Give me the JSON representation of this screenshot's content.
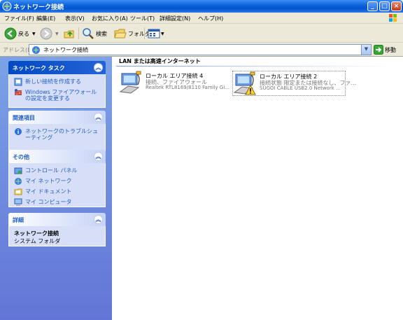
{
  "window": {
    "title": "ネットワーク接続"
  },
  "menubar": [
    "ファイル(F)",
    "編集(E)",
    "表示(V)",
    "お気に入り(A)",
    "ツール(T)",
    "詳細設定(N)",
    "ヘルプ(H)"
  ],
  "toolbar": {
    "back": "戻る",
    "search": "検索",
    "folders": "フォルダ"
  },
  "address": {
    "label": "アドレス(D)",
    "value": "ネットワーク接続",
    "go": "移動"
  },
  "sidebar": {
    "tasks": {
      "title": "ネットワーク タスク",
      "items": [
        "新しい接続を作成する",
        "Windows ファイアウォールの設定を変更する"
      ]
    },
    "related": {
      "title": "関連項目",
      "items": [
        "ネットワークのトラブルシューティング"
      ]
    },
    "other": {
      "title": "その他",
      "items": [
        "コントロール パネル",
        "マイ ネットワーク",
        "マイ ドキュメント",
        "マイ コンピュータ"
      ]
    },
    "details": {
      "title": "詳細",
      "name": "ネットワーク接続",
      "type": "システム フォルダ"
    }
  },
  "content": {
    "group_title": "LAN または高速インターネット",
    "connections": [
      {
        "name": "ローカル エリア接続 4",
        "status": "接続、ファイアウォール",
        "device": "Realtek RTL8169/8110 Family Gi..."
      },
      {
        "name": "ローカル エリア接続 2",
        "status": "接続状態 限定または接続なし、ファ...",
        "device": "SUGOI CABLE USB2.0 Network ..."
      }
    ]
  }
}
